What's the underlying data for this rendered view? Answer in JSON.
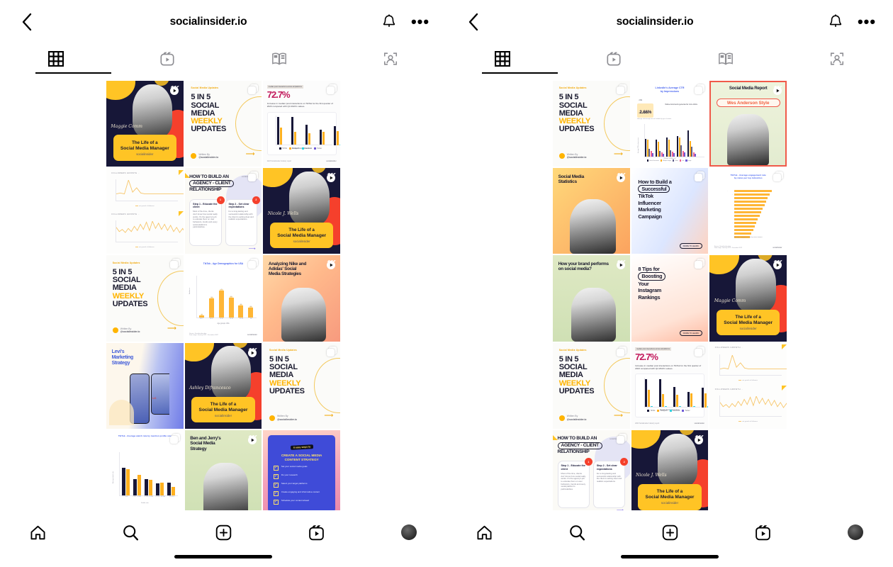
{
  "app": "instagram",
  "panels": [
    {
      "id": "left-panel"
    },
    {
      "id": "right-panel"
    }
  ],
  "header": {
    "title": "socialinsider.io",
    "back_icon": "chevron-left-icon",
    "notifications_icon": "bell-icon",
    "more_icon": "more-options-icon",
    "more_label": "•••"
  },
  "tabs": [
    {
      "key": "grid",
      "icon": "grid-icon",
      "label": "Posts",
      "active": true
    },
    {
      "key": "reels",
      "icon": "reels-icon",
      "label": "Reels",
      "active": false
    },
    {
      "key": "guides",
      "icon": "guides-icon",
      "label": "Guides",
      "active": false
    },
    {
      "key": "tagged",
      "icon": "tagged-icon",
      "label": "Tagged",
      "active": false
    }
  ],
  "bottom_nav": [
    {
      "key": "home",
      "icon": "home-icon",
      "label": "Home"
    },
    {
      "key": "search",
      "icon": "search-icon",
      "label": "Search"
    },
    {
      "key": "create",
      "icon": "plus-box-icon",
      "label": "Create"
    },
    {
      "key": "reels",
      "icon": "reels-icon",
      "label": "Reels"
    },
    {
      "key": "profile",
      "icon": "avatar-icon",
      "label": "Profile"
    }
  ],
  "home_indicator": "home-indicator-bar",
  "colors": {
    "brand_yellow": "#ffc425",
    "brand_navy": "#171738",
    "brand_red": "#f5402c",
    "accent_orange": "#f0a500",
    "accent_blue": "#4a66f0",
    "magenta": "#c2185b",
    "teal": "#2ed3e0",
    "purple": "#6f5bd6"
  },
  "common": {
    "kicker": "Social Media Updates",
    "five_in_five": {
      "l1": "5 IN 5",
      "l2": "SOCIAL",
      "l3": "MEDIA",
      "l4": "WEEKLY",
      "l5": "UPDATES"
    },
    "written_by": "Written By",
    "handle": "@socialinsider.io",
    "life_caption": {
      "l1": "The Life of a",
      "l2": "Social Media Manager",
      "brand": "socialinsider"
    },
    "stat_72": {
      "eyebrow": "median post interactions across all platforms",
      "value": "72.7%",
      "body": "Increase in median post interactions on TikTok for the first quarter of 2023 compared with Q4 2022's values.",
      "axis_label": "Median Posts Interactions",
      "legend": [
        "TikTok",
        "Instagram",
        "Facebook",
        "Twitter"
      ],
      "footer": "2023 Socialinsider Industry report",
      "brand": "socialinsider"
    },
    "followers_growth": {
      "title": "FOLLOWERS GROWTH",
      "legend": "net growth of followers"
    },
    "agency": {
      "title_l1": "HOW TO BUILD AN",
      "title_l2": "AGENCY - CLIENT",
      "title_l3": "RELATIONSHIP",
      "badge": "socialinsider",
      "step1_num": "1",
      "step1_title": "Step 1 - Educate the client",
      "step1_text": "Most of the time, clients don't know how social really works. It's the agency's job to educate them on user behaviors, trends and every social platform's particularities.",
      "step2_num": "2",
      "step2_title": "Step 2 - Set clear expectations",
      "step2_text": "For a long-lasting and successful relationship with the client is setting clear and realistic expectations."
    }
  },
  "left_grid": [
    {
      "name": "tile-maggie-comm-reel",
      "kind": "life-dark",
      "person": "Maggie Comm",
      "badge": "reel",
      "has_badge": true
    },
    {
      "name": "tile-5in5-updates-a",
      "kind": "five-in-five",
      "badge": "carousel",
      "has_badge": true
    },
    {
      "name": "tile-stat-72-7-percent-a",
      "kind": "stat-72",
      "badge": "carousel",
      "has_badge": true
    },
    {
      "name": "tile-followers-growth-charts",
      "kind": "followers-growth",
      "has_badge": false
    },
    {
      "name": "tile-agency-client-relationship-a",
      "kind": "agency",
      "badge": "carousel",
      "has_badge": true
    },
    {
      "name": "tile-nicole-j-wells-reel",
      "kind": "life-dark",
      "person": "Nicole J. Wells",
      "badge": "reel",
      "has_badge": true
    },
    {
      "name": "tile-5in5-updates-b",
      "kind": "five-in-five",
      "badge": "carousel",
      "has_badge": true
    },
    {
      "name": "tile-tiktok-age-demographics-usa",
      "kind": "chart-age-demo",
      "badge": "carousel",
      "has_badge": true,
      "title": "TikTok - Age Demographics for USA",
      "xlabel": "Age groups USA",
      "ylabel": "Audience",
      "source": "Source: Socialinsider data",
      "daterange": "Date range: January 2022 - December 2022",
      "brand": "socialinsider"
    },
    {
      "name": "tile-nike-adidas-strategies-reel",
      "kind": "headline-photo",
      "badge": "reel",
      "has_badge": true,
      "headline_lines": [
        "Analyzing Nike and",
        "Adidas' Social",
        "Media Strategies"
      ],
      "bg": "gradpeach"
    },
    {
      "name": "tile-levis-marketing-strategy",
      "kind": "levis",
      "has_badge": false,
      "headline_lines": [
        "Levi's",
        "Marketing",
        "Strategy"
      ]
    },
    {
      "name": "tile-ashley-difrancesco-reel",
      "kind": "life-dark",
      "person": "Ashley Difrancesco",
      "badge": "reel",
      "has_badge": true
    },
    {
      "name": "tile-5in5-updates-c",
      "kind": "five-in-five",
      "badge": "carousel",
      "has_badge": true
    },
    {
      "name": "tile-tiktok-watch-rate-chart",
      "kind": "chart-watch-rate",
      "badge": "carousel",
      "has_badge": true,
      "title": "TikTok - Average watch rate by mention profile size",
      "title_l2": "by profile size",
      "xlabel": "Profile size",
      "ylabel": "Average watch rate"
    },
    {
      "name": "tile-ben-jerrys-strategy-reel",
      "kind": "headline-photo",
      "badge": "reel",
      "has_badge": true,
      "headline_lines": [
        "Ben and Jerry's",
        "Social Media",
        "Strategy"
      ],
      "bg": "gradgreen"
    },
    {
      "name": "tile-content-strategy-steps",
      "kind": "checklist",
      "has_badge": false,
      "sticker": "6 easy steps to",
      "title_l1": "CREATE A SOCIAL MEDIA",
      "title_l2": "CONTENT STRATEGY",
      "items": [
        "Set your social media goals",
        "Do your research",
        "Select your target platforms",
        "Create engaging and informative content",
        "Schedule your content ahead"
      ]
    }
  ],
  "right_grid": [
    {
      "name": "tile-5in5-updates-d",
      "kind": "five-in-five",
      "badge": "carousel",
      "has_badge": true
    },
    {
      "name": "tile-linkedin-avg-ctr",
      "kind": "linkedin-ctr",
      "badge": "carousel",
      "has_badge": true,
      "title_l1": "LinkedIn's Average CTR",
      "title_l2": "by Impressions",
      "metric_label": "CTR",
      "metric_value": "2.66%",
      "metric_sub": "ON LINKEDIN",
      "note": "Native documents generate far more clicks.",
      "chart_sub": "Average click-through rate on LinkedIn by type of content",
      "xlabel": "Number of followers",
      "ylabel": "Average CTR by Impressions",
      "legend": [
        "Native Documents",
        "Multiple Images",
        "Video",
        "Link",
        "Image"
      ]
    },
    {
      "name": "tile-wes-anderson-report-reel",
      "kind": "wes-anderson",
      "badge": "reel",
      "has_badge": true,
      "headline": "Social Media Report",
      "sticker": "Wes Anderson Style"
    },
    {
      "name": "tile-social-media-statistics-reel",
      "kind": "stats-reel",
      "badge": "reel",
      "has_badge": true,
      "headline_lines": [
        "Social Media",
        "Statistics"
      ]
    },
    {
      "name": "tile-tiktok-influencer-campaign",
      "kind": "howto-tiktok",
      "badge": "carousel",
      "has_badge": true,
      "lines": [
        "How to Build a",
        "Successful",
        "TikTok",
        "Influencer",
        "Marketing",
        "Campaign"
      ],
      "pill_line_index": 1,
      "swipe": "SWIPE TO LEARN"
    },
    {
      "name": "tile-tiktok-engagement-industries",
      "kind": "chart-industries",
      "badge": "carousel",
      "has_badge": true,
      "title_l1": "TikTok - Average engagement rate",
      "title_l2": "by views per top industries",
      "xlabel": "Average engagement rate by views (mean)",
      "ylabel": "Industries",
      "source": "Source: Socialinsider data",
      "daterange": "Date range: January 2022 - December 2022",
      "brand": "socialinsider"
    },
    {
      "name": "tile-brand-performance-reel",
      "kind": "headline-photo",
      "badge": "reel",
      "has_badge": true,
      "headline_lines": [
        "How your brand performs",
        "on social media?"
      ],
      "bg": "gradgreen"
    },
    {
      "name": "tile-8-tips-instagram-rankings",
      "kind": "eight-tips",
      "badge": "carousel",
      "has_badge": true,
      "lines": [
        "8 Tips for",
        "Boosting",
        "Your",
        "Instagram",
        "Rankings"
      ],
      "pill_line_index": 1,
      "swipe": "SWIPE TO LEARN"
    },
    {
      "name": "tile-maggie-comm-reel-b",
      "kind": "life-dark",
      "person": "Maggie Comm",
      "badge": "reel",
      "has_badge": true
    },
    {
      "name": "tile-5in5-updates-e",
      "kind": "five-in-five",
      "badge": "carousel",
      "has_badge": true
    },
    {
      "name": "tile-stat-72-7-percent-b",
      "kind": "stat-72",
      "badge": "carousel",
      "has_badge": true
    },
    {
      "name": "tile-followers-growth-charts-b",
      "kind": "followers-growth",
      "has_badge": false
    },
    {
      "name": "tile-agency-client-relationship-b",
      "kind": "agency",
      "badge": "carousel",
      "has_badge": true
    },
    {
      "name": "tile-nicole-j-wells-reel-b",
      "kind": "life-dark",
      "person": "Nicole J. Wells",
      "badge": "reel",
      "has_badge": true
    }
  ],
  "chart_data": [
    {
      "type": "bar",
      "title": "Median Posts Interactions",
      "categories": [
        "Q4 2021",
        "Q1 2022",
        "Q2 2022",
        "Q3 2022",
        "Q4 2022"
      ],
      "series": [
        {
          "name": "TikTok",
          "values": [
            96,
            95,
            70,
            52,
            66
          ]
        },
        {
          "name": "Instagram",
          "values": [
            60,
            46,
            42,
            47,
            48
          ]
        },
        {
          "name": "Facebook",
          "values": [
            4,
            4,
            4,
            4,
            4
          ]
        },
        {
          "name": "Twitter",
          "values": [
            2,
            2,
            2,
            2,
            2
          ]
        }
      ],
      "xlabel": "Median Posts Interactions",
      "ylabel": "",
      "ylim": [
        0,
        100
      ],
      "legend_position": "bottom"
    },
    {
      "type": "bar",
      "title": "TikTok - Age Demographics for USA",
      "categories": [
        "13-17",
        "18-24",
        "25-34",
        "35-44",
        "45-54",
        "55+"
      ],
      "values": [
        6,
        52,
        72,
        53,
        32,
        26
      ],
      "xlabel": "Age groups USA",
      "ylabel": "Audience",
      "ylim": [
        0,
        80
      ]
    },
    {
      "type": "bar",
      "title": "TikTok - Average watch rate by mention profile size",
      "categories": [
        "1 - 5 000",
        "5 000 - 10 000",
        "10 000 - 50 000",
        "50 000 - 100 000",
        "100 000 +"
      ],
      "series": [
        {
          "name": "2021",
          "values": [
            78,
            46,
            46,
            34,
            36
          ]
        },
        {
          "name": "2022",
          "values": [
            74,
            57,
            43,
            36,
            24
          ]
        }
      ],
      "xlabel": "Profile size",
      "ylabel": "Average watch rate",
      "ylim": [
        0,
        80
      ]
    },
    {
      "type": "bar",
      "title": "LinkedIn's Average CTR by Impressions",
      "categories": [
        "1-1 000",
        "1 000-5 000",
        "5 000-10 000",
        "10 000-50 000",
        "50 000 +"
      ],
      "series": [
        {
          "name": "Native Documents",
          "values": [
            62,
            60,
            66,
            72,
            92
          ]
        },
        {
          "name": "Multiple Images",
          "values": [
            58,
            52,
            58,
            66,
            54
          ]
        },
        {
          "name": "Video",
          "values": [
            26,
            20,
            22,
            40,
            34
          ]
        },
        {
          "name": "Link",
          "values": [
            18,
            14,
            16,
            18,
            14
          ]
        },
        {
          "name": "Image",
          "values": [
            12,
            10,
            12,
            14,
            10
          ]
        }
      ],
      "xlabel": "Number of followers",
      "ylabel": "Average CTR by Impressions",
      "ylim": [
        0,
        100
      ],
      "legend_position": "bottom"
    },
    {
      "type": "bar",
      "orientation": "horizontal",
      "title": "TikTok - Average engagement rate by views per top industries",
      "categories": [
        "Sports Teams",
        "Food & Beverage",
        "Influencers",
        "Health & Beauty",
        "Fashion",
        "Travel",
        "Home Decor",
        "Alcohol",
        "Finance",
        "Technology",
        "Retail",
        "Automotive",
        "Non-Profit",
        "Education"
      ],
      "values": [
        92,
        86,
        82,
        78,
        74,
        70,
        66,
        62,
        58,
        54,
        50,
        46,
        42,
        38
      ],
      "xlabel": "Average engagement rate by views (mean)",
      "ylabel": "Industries"
    },
    {
      "type": "line",
      "title": "FOLLOWERS GROWTH",
      "series": [
        {
          "name": "net growth of followers",
          "values": [
            2,
            3,
            2,
            18,
            4,
            9,
            3,
            2,
            2,
            2,
            2,
            2,
            2,
            2,
            2,
            2,
            2,
            2
          ]
        }
      ],
      "xlabel": "",
      "ylabel": ""
    },
    {
      "type": "line",
      "title": "FOLLOWERS GROWTH",
      "series": [
        {
          "name": "net growth of followers",
          "values": [
            9,
            5,
            7,
            4,
            8,
            5,
            10,
            6,
            12,
            7,
            14,
            6,
            15,
            8,
            13,
            7,
            12,
            6,
            11,
            5,
            9,
            4,
            8,
            3
          ]
        }
      ],
      "xlabel": "",
      "ylabel": ""
    }
  ]
}
